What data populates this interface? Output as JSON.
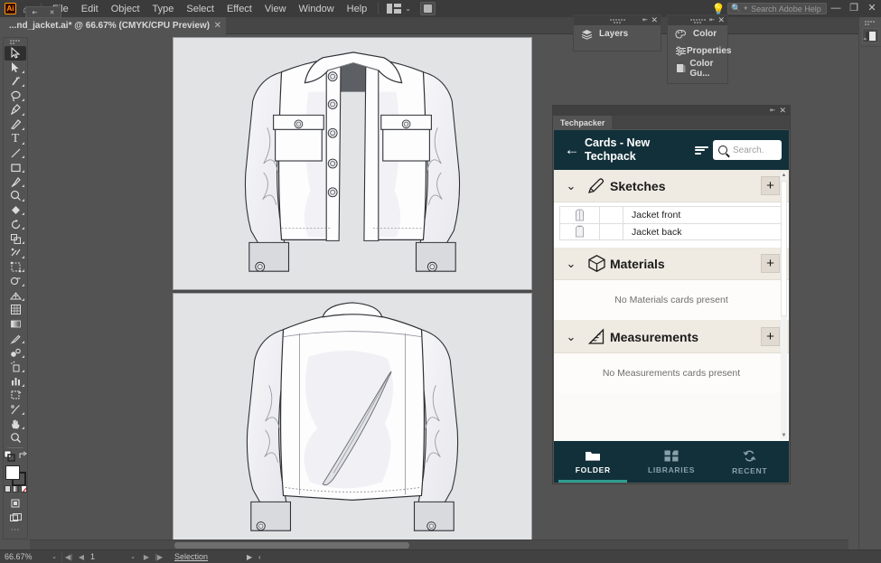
{
  "app": {
    "name": "Adobe Illustrator",
    "logo_text": "Ai",
    "home_icon": "home-icon",
    "menu": [
      "File",
      "Edit",
      "Object",
      "Type",
      "Select",
      "Effect",
      "View",
      "Window",
      "Help"
    ],
    "arrange_icon": "arrange-documents-icon",
    "arrange_chevron": "⌄",
    "document_setup_icon": "document-setup-icon",
    "help_bulb_icon": "lightbulb-icon",
    "help_search_placeholder": "Search Adobe Help",
    "window_minimize": "—",
    "window_restore": "❐",
    "window_close": "✕"
  },
  "document_tab": {
    "title": "...nd_jacket.ai* @ 66.67% (CMYK/CPU Preview)",
    "close_icon": "✕",
    "mini_widget": {
      "dock_icon": "⇤",
      "close_icon": "✕"
    }
  },
  "toolbar": {
    "tools": [
      {
        "name": "selection-tool",
        "glyph": "▷",
        "selected": true,
        "submenu": false
      },
      {
        "name": "direct-selection-tool",
        "glyph": "➤",
        "selected": false,
        "submenu": true
      },
      {
        "name": "magic-wand-tool",
        "glyph": "⚡",
        "selected": false,
        "submenu": true
      },
      {
        "name": "lasso-tool",
        "glyph": "◌",
        "selected": false,
        "submenu": true
      },
      {
        "name": "pen-tool",
        "glyph": "✒",
        "selected": false,
        "submenu": true
      },
      {
        "name": "curvature-tool",
        "glyph": "✎",
        "selected": false,
        "submenu": true
      },
      {
        "name": "type-tool",
        "glyph": "T",
        "selected": false,
        "submenu": true
      },
      {
        "name": "line-segment-tool",
        "glyph": "╱",
        "selected": false,
        "submenu": true
      },
      {
        "name": "rectangle-tool",
        "glyph": "▭",
        "selected": false,
        "submenu": true
      },
      {
        "name": "paintbrush-tool",
        "glyph": "🖌",
        "selected": false,
        "submenu": true
      },
      {
        "name": "shaper-tool",
        "glyph": "◯",
        "selected": false,
        "submenu": true
      },
      {
        "name": "eraser-tool",
        "glyph": "◆",
        "selected": false,
        "submenu": true
      },
      {
        "name": "rotate-tool",
        "glyph": "↻",
        "selected": false,
        "submenu": true
      },
      {
        "name": "scale-tool",
        "glyph": "⧉",
        "selected": false,
        "submenu": true
      },
      {
        "name": "width-tool",
        "glyph": "✄",
        "selected": false,
        "submenu": true
      },
      {
        "name": "free-transform-tool",
        "glyph": "⛶",
        "selected": false,
        "submenu": true
      },
      {
        "name": "shape-builder-tool",
        "glyph": "◖",
        "selected": false,
        "submenu": true
      },
      {
        "name": "perspective-grid-tool",
        "glyph": "▨",
        "selected": false,
        "submenu": true
      },
      {
        "name": "mesh-tool",
        "glyph": "▦",
        "selected": false,
        "submenu": false
      },
      {
        "name": "gradient-tool",
        "glyph": "▤",
        "selected": false,
        "submenu": false
      },
      {
        "name": "eyedropper-tool",
        "glyph": "✐",
        "selected": false,
        "submenu": true
      },
      {
        "name": "blend-tool",
        "glyph": "❧",
        "selected": false,
        "submenu": true
      },
      {
        "name": "symbol-sprayer-tool",
        "glyph": "⚙",
        "selected": false,
        "submenu": true
      },
      {
        "name": "column-graph-tool",
        "glyph": "▥",
        "selected": false,
        "submenu": true
      },
      {
        "name": "artboard-tool",
        "glyph": "⬓",
        "selected": false,
        "submenu": false
      },
      {
        "name": "slice-tool",
        "glyph": "✂",
        "selected": false,
        "submenu": true
      },
      {
        "name": "hand-tool",
        "glyph": "✋",
        "selected": false,
        "submenu": true
      },
      {
        "name": "zoom-tool",
        "glyph": "🔍",
        "selected": false,
        "submenu": false
      }
    ],
    "fill_color": "#ffffff",
    "stroke_color": "#1e1e1e",
    "swap_icon": "swap-fill-stroke-icon",
    "default_colors_icon": "default-colors-icon",
    "color_mode_icons": [
      "color-swatch-icon",
      "gradient-swatch-icon",
      "none-swatch-icon"
    ],
    "drawing_mode_icon": "draw-normal-icon",
    "screen_mode_icon": "change-screen-mode-icon",
    "more_tools_icon": "edit-toolbar-icon"
  },
  "canvas": {
    "artboards": [
      {
        "name": "artboard-jacket-front",
        "content": "Jacket front technical flat sketch"
      },
      {
        "name": "artboard-jacket-back",
        "content": "Jacket back technical flat sketch"
      }
    ],
    "background_color": "#535353",
    "artboard_color": "#e2e3e5"
  },
  "floating_panels": [
    {
      "name": "layers-panel-group",
      "dock_icon": "⇤",
      "close_icon": "✕",
      "rows": [
        {
          "label": "Layers",
          "icon": "layers-icon"
        }
      ]
    },
    {
      "name": "color-panel-group",
      "dock_icon": "⇤",
      "close_icon": "✕",
      "rows": [
        {
          "label": "Color",
          "icon": "color-wheel-icon"
        },
        {
          "label": "Properties",
          "icon": "properties-sliders-icon"
        },
        {
          "label": "Color Gu...",
          "icon": "color-guide-icon"
        }
      ]
    }
  ],
  "techpacker": {
    "panel_title_dock_icon": "⇤",
    "panel_title_close_icon": "✕",
    "tab_label": "Techpacker",
    "header": {
      "back_icon": "←",
      "title": "Cards - New Techpack",
      "sort_icon": "sort-icon",
      "search_icon": "search-icon",
      "search_placeholder": "Search.",
      "background_color": "#12303a"
    },
    "sections": [
      {
        "name": "sketches",
        "label": "Sketches",
        "icon": "pencil-icon",
        "chevron": "⌄",
        "add_label": "+",
        "empty_text": null,
        "cards": [
          {
            "name": "Jacket front",
            "thumb": "jacket-front-thumb"
          },
          {
            "name": "Jacket back",
            "thumb": "jacket-back-thumb"
          }
        ]
      },
      {
        "name": "materials",
        "label": "Materials",
        "icon": "cube-icon",
        "chevron": "⌄",
        "add_label": "+",
        "empty_text": "No Materials cards present",
        "cards": []
      },
      {
        "name": "measurements",
        "label": "Measurements",
        "icon": "ruler-triangle-icon",
        "chevron": "⌄",
        "add_label": "+",
        "empty_text": "No Measurements cards present",
        "cards": []
      }
    ],
    "scrollbar": {
      "up_arrow": "▲",
      "down_arrow": "▼"
    },
    "bottom_nav": [
      {
        "name": "folder",
        "label": "FOLDER",
        "icon": "folder-icon",
        "active": true
      },
      {
        "name": "libraries",
        "label": "LIBRARIES",
        "icon": "libraries-grid-icon",
        "active": false
      },
      {
        "name": "recent",
        "label": "RECENT",
        "icon": "recent-refresh-icon",
        "active": false
      }
    ],
    "accent_color": "#2f9e8f"
  },
  "right_dock": {
    "collapse_icon": "⌃",
    "panel_icon": "gradient-panel-icon"
  },
  "statusbar": {
    "zoom_level": "66.67%",
    "zoom_chevron": "⌄",
    "nav_first": "◀|",
    "nav_prev": "◀",
    "page_number": "1",
    "page_chevron": "⌄",
    "nav_next": "▶",
    "nav_last": "|▶",
    "tool_status": "Selection",
    "status_arrow": "▶",
    "resize_arrow": "‹"
  }
}
